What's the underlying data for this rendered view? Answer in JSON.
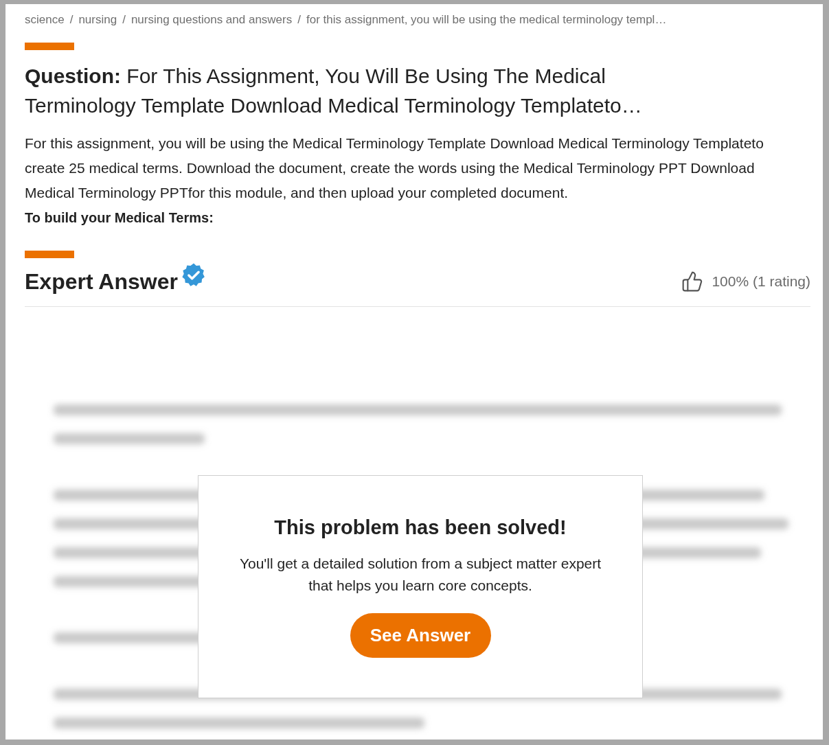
{
  "breadcrumb": [
    {
      "text": "science"
    },
    {
      "separator": "/",
      "text": "nursing"
    },
    {
      "separator": "/",
      "text": "nursing questions and answers"
    },
    {
      "separator": "/",
      "text": "for this assignment, you will be using the medical terminology templ…"
    }
  ],
  "question": {
    "label": "Question:",
    "title": "For This Assignment, You Will Be Using The Medical Terminology Template Download Medical Terminology Templateto…",
    "body": "For this assignment, you will be using the Medical Terminology Template Download Medical Terminology Templateto create 25 medical terms. Download the document, create the words using the Medical Terminology PPT Download Medical Terminology PPTfor this module, and then upload your completed document.",
    "subheading": "To build your Medical Terms:"
  },
  "answer": {
    "heading": "Expert Answer",
    "verified": true,
    "rating": "100% (1 rating)"
  },
  "paywall": {
    "title": "This problem has been solved!",
    "text": "You'll get a detailed solution from a subject matter expert that helps you learn core concepts.",
    "button": "See Answer"
  }
}
